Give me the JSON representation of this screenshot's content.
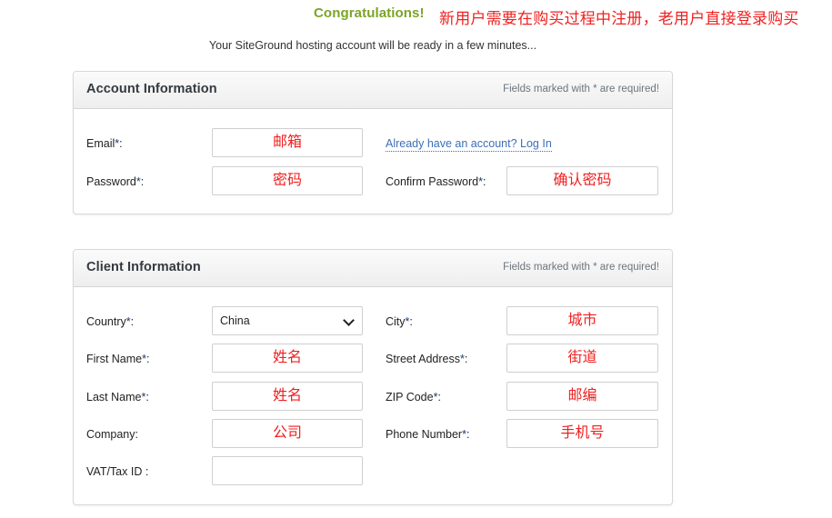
{
  "banner": {
    "congratulations": "Congratulations!",
    "annotation_cn": "新用户需要在购买过程中注册，老用户直接登录购买",
    "subtitle": "Your SiteGround hosting account will be ready in a few minutes...",
    "congrats_color": "#7ba428",
    "annotation_color": "#f02020"
  },
  "account_panel": {
    "title": "Account Information",
    "required_note": "Fields marked with * are required!",
    "fields": {
      "email": {
        "label": "Email*:",
        "value": "邮箱",
        "placeholder": ""
      },
      "password": {
        "label": "Password*:",
        "value": "密码",
        "placeholder": ""
      },
      "confirm_password": {
        "label": "Confirm Password*:",
        "value": "确认密码",
        "placeholder": ""
      }
    },
    "login_link": "Already have an account? Log In"
  },
  "client_panel": {
    "title": "Client Information",
    "required_note": "Fields marked with * are required!",
    "fields": {
      "country": {
        "label": "Country*:",
        "value": "China",
        "options": [
          "China"
        ]
      },
      "city": {
        "label": "City*:",
        "value": "城市",
        "placeholder": ""
      },
      "first_name": {
        "label": "First Name*:",
        "value": "姓名",
        "placeholder": ""
      },
      "street_address": {
        "label": "Street Address*:",
        "value": "街道",
        "placeholder": ""
      },
      "last_name": {
        "label": "Last Name*:",
        "value": "姓名",
        "placeholder": ""
      },
      "zip_code": {
        "label": "ZIP Code*:",
        "value": "邮编",
        "placeholder": ""
      },
      "company": {
        "label": "Company:",
        "value": "公司",
        "placeholder": ""
      },
      "phone_number": {
        "label": "Phone Number*:",
        "value": "手机号",
        "placeholder": ""
      },
      "vat_tax_id": {
        "label": "VAT/Tax ID :",
        "value": "",
        "placeholder": ""
      }
    }
  }
}
